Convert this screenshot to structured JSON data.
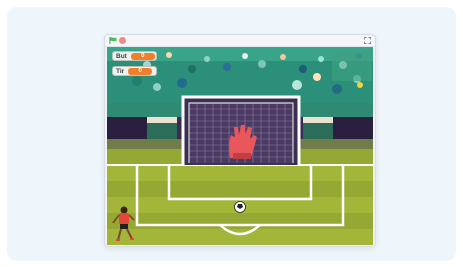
{
  "toolbar": {
    "green_flag_icon": "green-flag-icon",
    "stop_icon": "stop-sign-icon",
    "fullscreen_icon": "fullscreen-icon"
  },
  "monitors": {
    "but": {
      "label": "But",
      "value": "0"
    },
    "tir": {
      "label": "Tir",
      "value": "0"
    }
  },
  "colors": {
    "monitor_value": "#f07f2b",
    "crowd_back": "#2b8f79",
    "pitch": "#a3b63a",
    "ball": "#ffffff",
    "goalkeeper_glove": "#e9565b"
  }
}
